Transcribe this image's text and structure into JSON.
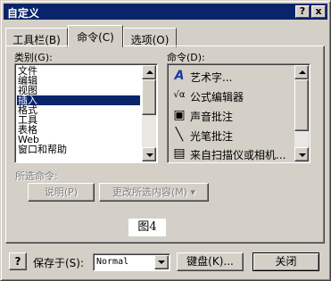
{
  "window": {
    "title": "自定义",
    "help_glyph": "?",
    "close_glyph": "x"
  },
  "tabs": [
    {
      "label": "工具栏(B)"
    },
    {
      "label": "命令(C)"
    },
    {
      "label": "选项(O)"
    }
  ],
  "categories": {
    "label": "类别(G):",
    "items": [
      "文件",
      "编辑",
      "视图",
      "插入",
      "格式",
      "工具",
      "表格",
      "Web",
      "窗口和帮助"
    ],
    "selected": "插入"
  },
  "commands": {
    "label": "命令(D):",
    "items": [
      {
        "label": "艺术字...",
        "icon": "wordart-icon",
        "glyph": "A"
      },
      {
        "label": "公式编辑器",
        "icon": "equation-icon",
        "glyph": "√α"
      },
      {
        "label": "声音批注",
        "icon": "sound-comment-icon",
        "glyph": "▣"
      },
      {
        "label": "光笔批注",
        "icon": "pen-comment-icon",
        "glyph": "╲"
      },
      {
        "label": "来自扫描仪或相机...",
        "icon": "scanner-icon",
        "glyph": "▤"
      }
    ]
  },
  "selected_command": {
    "label": "所选命令:",
    "describe_button": "说明(P)",
    "modify_button": "更改所选内容(M) ▾"
  },
  "caption": "图4",
  "footer": {
    "help_glyph": "?",
    "save_in_label": "保存于(S):",
    "save_in_value": "Normal",
    "keyboard_button": "键盘(K)...",
    "close_button": "关闭"
  },
  "colors": {
    "titlebar": "#0a246a",
    "selection": "#0a246a",
    "face": "#d4d0c8"
  }
}
